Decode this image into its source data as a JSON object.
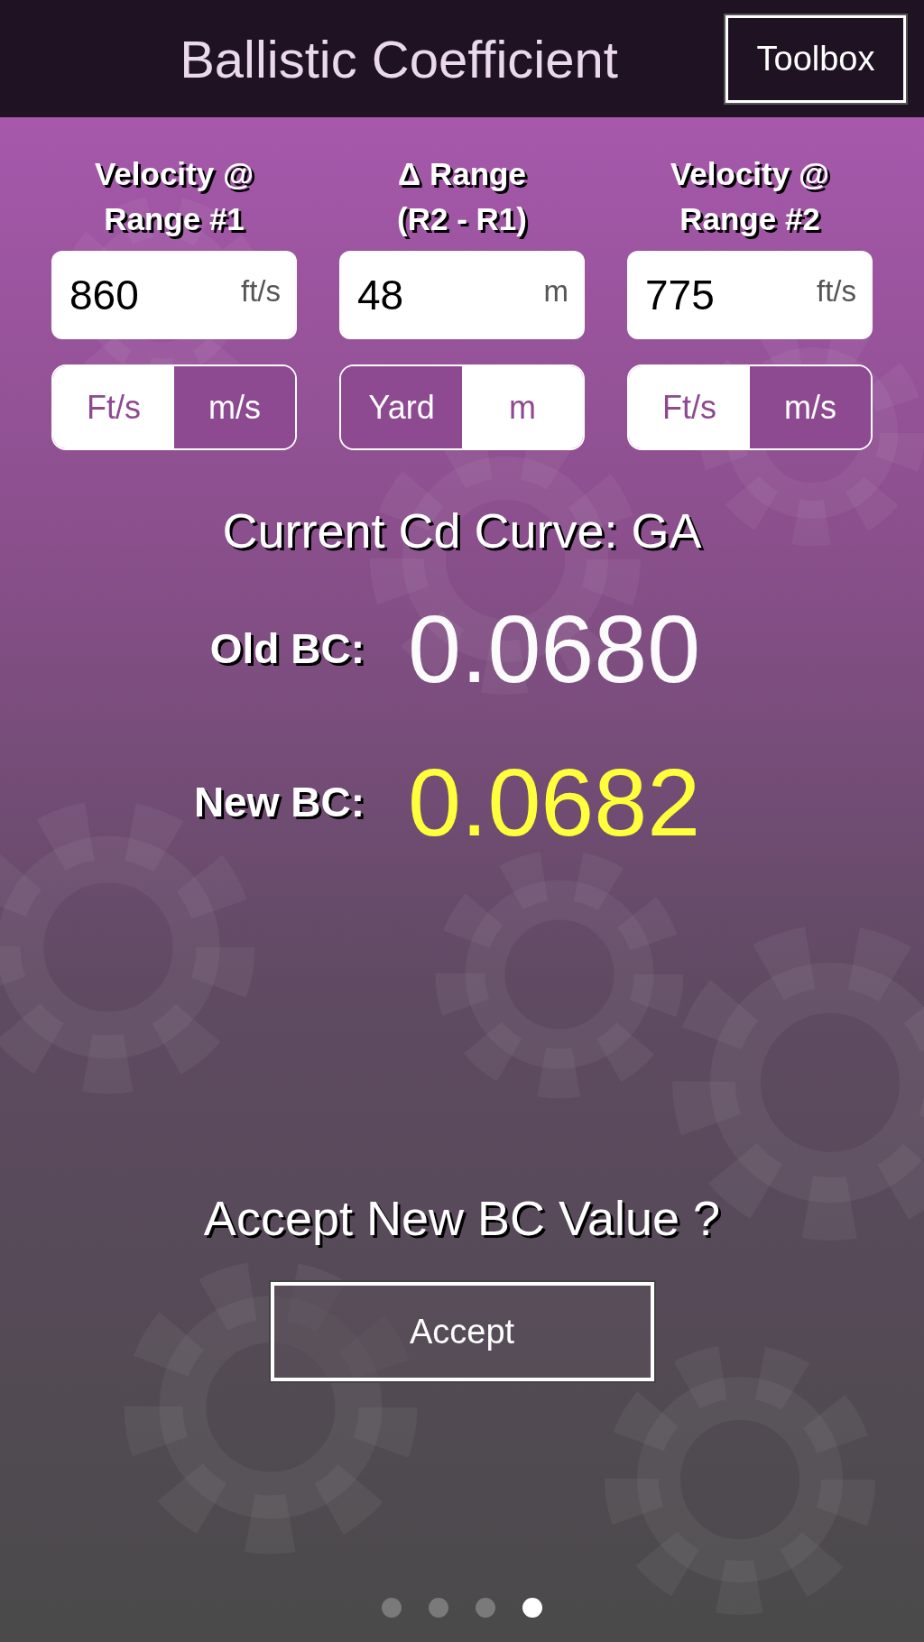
{
  "header": {
    "title": "Ballistic Coefficient",
    "toolbox_button": "Toolbox"
  },
  "inputs": [
    {
      "label": "Velocity @\nRange #1",
      "value": "860",
      "unit": "ft/s",
      "options": [
        {
          "label": "Ft/s",
          "selected": false
        },
        {
          "label": "m/s",
          "selected": true
        }
      ]
    },
    {
      "label": "Δ Range\n(R2 - R1)",
      "value": "48",
      "unit": "m",
      "options": [
        {
          "label": "Yard",
          "selected": true
        },
        {
          "label": "m",
          "selected": false
        }
      ]
    },
    {
      "label": "Velocity @\nRange #2",
      "value": "775",
      "unit": "ft/s",
      "options": [
        {
          "label": "Ft/s",
          "selected": false
        },
        {
          "label": "m/s",
          "selected": true
        }
      ]
    }
  ],
  "curve": "Current Cd Curve: GA",
  "results": [
    {
      "label": "Old BC:",
      "value": "0.0680",
      "kind": "old"
    },
    {
      "label": "New BC:",
      "value": "0.0682",
      "kind": "new"
    }
  ],
  "prompt": "Accept New BC Value ?",
  "accept_button": "Accept",
  "pages": [
    {
      "selected": false
    },
    {
      "selected": false
    },
    {
      "selected": false
    },
    {
      "selected": true
    }
  ]
}
